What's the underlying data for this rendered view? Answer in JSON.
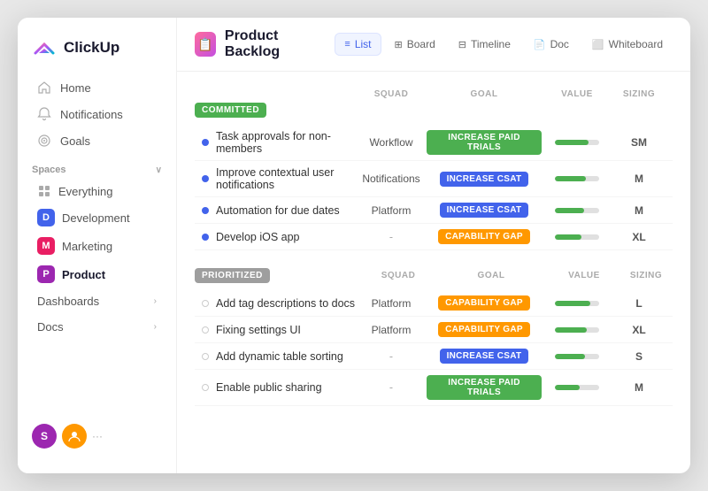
{
  "app": {
    "name": "ClickUp"
  },
  "sidebar": {
    "nav": [
      {
        "id": "home",
        "label": "Home",
        "icon": "🏠"
      },
      {
        "id": "notifications",
        "label": "Notifications",
        "icon": "🔔"
      },
      {
        "id": "goals",
        "label": "Goals",
        "icon": "🎯"
      }
    ],
    "spaces_label": "Spaces",
    "spaces": [
      {
        "id": "everything",
        "label": "Everything",
        "color": null
      },
      {
        "id": "development",
        "label": "Development",
        "color": "#4263eb",
        "letter": "D"
      },
      {
        "id": "marketing",
        "label": "Marketing",
        "color": "#e91e63",
        "letter": "M"
      },
      {
        "id": "product",
        "label": "Product",
        "color": "#9c27b0",
        "letter": "P",
        "active": true
      }
    ],
    "bottom_nav": [
      {
        "id": "dashboards",
        "label": "Dashboards"
      },
      {
        "id": "docs",
        "label": "Docs"
      }
    ]
  },
  "topbar": {
    "page_title": "Product Backlog",
    "page_icon": "📋",
    "tabs": [
      {
        "id": "list",
        "label": "List",
        "active": true
      },
      {
        "id": "board",
        "label": "Board"
      },
      {
        "id": "timeline",
        "label": "Timeline"
      },
      {
        "id": "doc",
        "label": "Doc"
      },
      {
        "id": "whiteboard",
        "label": "Whiteboard"
      }
    ]
  },
  "columns": {
    "task": "",
    "squad": "SQUAD",
    "goal": "GOAL",
    "value": "VALUE",
    "sizing": "SIZING"
  },
  "sections": [
    {
      "id": "committed",
      "badge_label": "COMMITTED",
      "badge_type": "committed",
      "tasks": [
        {
          "name": "Task approvals for non-members",
          "squad": "Workflow",
          "goal": "INCREASE PAID TRIALS",
          "goal_type": "green",
          "value_pct": 75,
          "sizing": "SM",
          "dot": "filled"
        },
        {
          "name": "Improve contextual user notifications",
          "squad": "Notifications",
          "goal": "INCREASE CSAT",
          "goal_type": "blue",
          "value_pct": 70,
          "sizing": "M",
          "dot": "filled"
        },
        {
          "name": "Automation for due dates",
          "squad": "Platform",
          "goal": "INCREASE CSAT",
          "goal_type": "blue",
          "value_pct": 65,
          "sizing": "M",
          "dot": "filled"
        },
        {
          "name": "Develop iOS app",
          "squad": "-",
          "goal": "CAPABILITY GAP",
          "goal_type": "orange",
          "value_pct": 60,
          "sizing": "XL",
          "dot": "filled"
        }
      ]
    },
    {
      "id": "prioritized",
      "badge_label": "PRIORITIZED",
      "badge_type": "prioritized",
      "tasks": [
        {
          "name": "Add tag descriptions to docs",
          "squad": "Platform",
          "goal": "CAPABILITY GAP",
          "goal_type": "orange",
          "value_pct": 80,
          "sizing": "L",
          "dot": "empty"
        },
        {
          "name": "Fixing settings UI",
          "squad": "Platform",
          "goal": "CAPABILITY GAP",
          "goal_type": "orange",
          "value_pct": 72,
          "sizing": "XL",
          "dot": "empty"
        },
        {
          "name": "Add dynamic table sorting",
          "squad": "-",
          "goal": "INCREASE CSAT",
          "goal_type": "blue",
          "value_pct": 68,
          "sizing": "S",
          "dot": "empty"
        },
        {
          "name": "Enable public sharing",
          "squad": "-",
          "goal": "INCREASE PAID TRIALS",
          "goal_type": "green",
          "value_pct": 55,
          "sizing": "M",
          "dot": "empty"
        }
      ]
    }
  ]
}
